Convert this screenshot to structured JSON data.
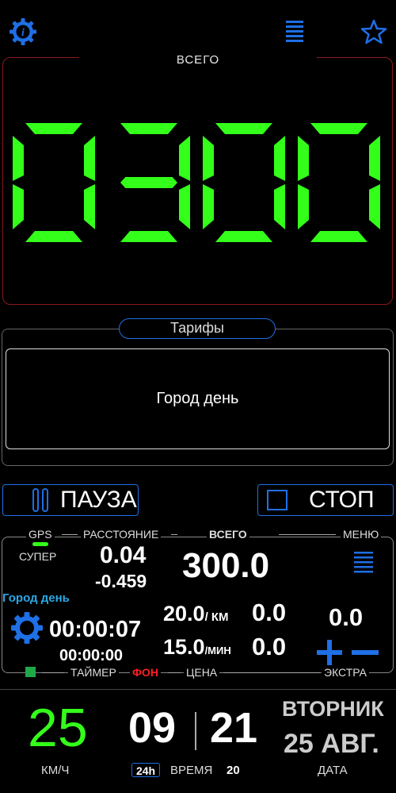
{
  "header": {
    "info_icon": "info-gear-icon",
    "menu_icon": "menu-icon",
    "star_icon": "star-icon"
  },
  "total": {
    "label": "ВСЕГО",
    "display": "0300"
  },
  "tariffs": {
    "title": "Тарифы",
    "selected": "Город день"
  },
  "controls": {
    "pause_label": "ПАУЗА",
    "stop_label": "СТОП"
  },
  "info": {
    "gps_label": "GPS",
    "gps_quality": "СУПЕР",
    "distance_label": "РАССТОЯНИЕ",
    "total_label": "ВСЕГО",
    "menu_label": "МЕНЮ",
    "distance_value": "0.04",
    "distance_delta": "-0.459",
    "total_value": "300.0",
    "tariff_name": "Город день",
    "timer_value": "00:00:07",
    "timer_sub": "00:00:00",
    "rate_km": "20.0",
    "rate_km_unit": "/ КМ",
    "rate_km_value": "0.0",
    "rate_min": "15.0",
    "rate_min_unit": "/МИН",
    "rate_min_value": "0.0",
    "extra_value": "0.0",
    "timer_label": "ТАЙМЕР",
    "bg_label": "ФОН",
    "price_label": "ЦЕНА",
    "extra_label": "ЭКСТРА"
  },
  "bottom": {
    "speed": "25",
    "speed_unit": "КМ/Ч",
    "hours": "09",
    "minutes": "21",
    "format_badge": "24h",
    "time_label": "ВРЕМЯ",
    "seconds": "20",
    "weekday": "ВТОРНИК",
    "date": "25 АВГ.",
    "date_label": "ДАТА"
  },
  "colors": {
    "accent": "#1f6fe5",
    "lcd_green": "#33ff1a",
    "danger": "#ff2020",
    "panel_border_red": "#8a1a1a"
  }
}
